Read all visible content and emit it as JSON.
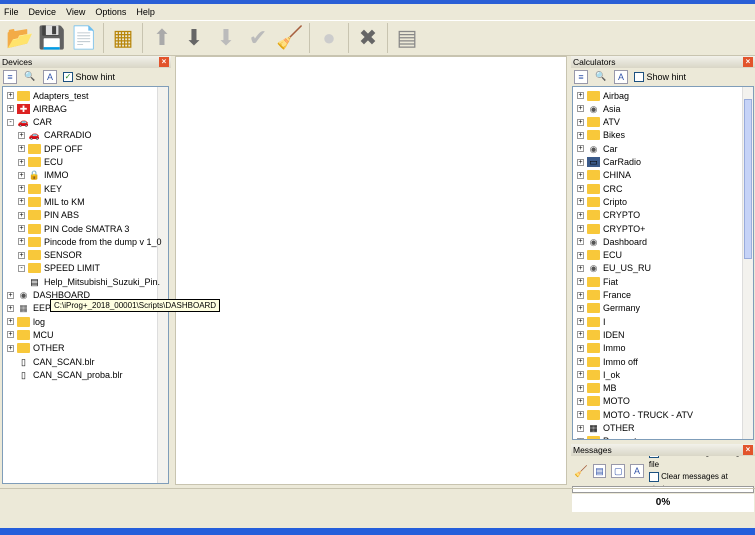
{
  "menu": [
    "File",
    "Device",
    "View",
    "Options",
    "Help"
  ],
  "toolbar": [
    {
      "icon": "open-folder-icon",
      "g": "📂",
      "c": "#3a7bd5"
    },
    {
      "icon": "save-download-icon",
      "g": "💾",
      "c": "#3a9a3a"
    },
    {
      "icon": "new-script-icon",
      "g": "📄",
      "c": "#c80"
    },
    "sep",
    {
      "icon": "device-chip-icon",
      "g": "▦",
      "c": "#b8860b"
    },
    "sep",
    {
      "icon": "arrow-up-icon",
      "g": "⬆",
      "c": "#aaa"
    },
    {
      "icon": "arrow-down-icon",
      "g": "⬇",
      "c": "#666"
    },
    {
      "icon": "arrow-down-disabled-icon",
      "g": "⬇",
      "c": "#bbb"
    },
    {
      "icon": "check-icon",
      "g": "✔",
      "c": "#bbb"
    },
    {
      "icon": "broom-icon",
      "g": "🧹",
      "c": "#bbb"
    },
    "sep",
    {
      "icon": "stop-circle-icon",
      "g": "●",
      "c": "#ccc"
    },
    "sep",
    {
      "icon": "close-x-icon",
      "g": "✖",
      "c": "#666"
    },
    "sep",
    {
      "icon": "calculator-icon",
      "g": "▤",
      "c": "#888"
    }
  ],
  "devices": {
    "title": "Devices",
    "show_hint": "Show hint",
    "show_hint_checked": true,
    "items": [
      {
        "label": "Adapters_test",
        "level": 0,
        "icon": "folder",
        "exp": "+"
      },
      {
        "label": "AIRBAG",
        "level": 0,
        "icon": "airbag",
        "exp": "+"
      },
      {
        "label": "CAR",
        "level": 0,
        "icon": "car",
        "exp": "-"
      },
      {
        "label": "CARRADIO",
        "level": 1,
        "icon": "car",
        "exp": "+"
      },
      {
        "label": "DPF OFF",
        "level": 1,
        "icon": "folder",
        "exp": "+"
      },
      {
        "label": "ECU",
        "level": 1,
        "icon": "folder",
        "exp": "+"
      },
      {
        "label": "IMMO",
        "level": 1,
        "icon": "lock",
        "exp": "+"
      },
      {
        "label": "KEY",
        "level": 1,
        "icon": "folder",
        "exp": "+"
      },
      {
        "label": "MIL to KM",
        "level": 1,
        "icon": "folder",
        "exp": "+"
      },
      {
        "label": "PIN ABS",
        "level": 1,
        "icon": "folder",
        "exp": "+"
      },
      {
        "label": "PIN Code SMATRA 3",
        "level": 1,
        "icon": "folder",
        "exp": "+"
      },
      {
        "label": "Pincode from the dump v 1_0",
        "level": 1,
        "icon": "folder",
        "exp": "+"
      },
      {
        "label": "SENSOR",
        "level": 1,
        "icon": "folder",
        "exp": "+"
      },
      {
        "label": "SPEED LIMIT",
        "level": 1,
        "icon": "folder",
        "exp": "-"
      },
      {
        "label": "Help_Mitsubishi_Suzuki_Pin.",
        "level": 1,
        "icon": "script",
        "exp": ""
      },
      {
        "label": "DASHBOARD",
        "level": 0,
        "icon": "dashboard",
        "exp": "+"
      },
      {
        "label": "EEP",
        "level": 0,
        "icon": "chip",
        "exp": "+"
      },
      {
        "label": "log",
        "level": 0,
        "icon": "folder",
        "exp": "+"
      },
      {
        "label": "MCU",
        "level": 0,
        "icon": "folder",
        "exp": "+"
      },
      {
        "label": "OTHER",
        "level": 0,
        "icon": "folder",
        "exp": "+"
      },
      {
        "label": "CAN_SCAN.blr",
        "level": 0,
        "icon": "file",
        "exp": ""
      },
      {
        "label": "CAN_SCAN_proba.blr",
        "level": 0,
        "icon": "file",
        "exp": ""
      }
    ],
    "tooltip": "C:\\iProg+_2018_00001\\Scripts\\DASHBOARD"
  },
  "calculators": {
    "title": "Calculators",
    "show_hint": "Show hint",
    "show_hint_checked": false,
    "items": [
      {
        "label": "Airbag",
        "icon": "folder"
      },
      {
        "label": "Asia",
        "icon": "dashboard"
      },
      {
        "label": "ATV",
        "icon": "folder"
      },
      {
        "label": "Bikes",
        "icon": "folder"
      },
      {
        "label": "Car",
        "icon": "dashboard"
      },
      {
        "label": "CarRadio",
        "icon": "radio"
      },
      {
        "label": "CHINA",
        "icon": "folder"
      },
      {
        "label": "CRC",
        "icon": "folder"
      },
      {
        "label": "Cripto",
        "icon": "folder"
      },
      {
        "label": "CRYPTO",
        "icon": "folder"
      },
      {
        "label": "CRYPTO+",
        "icon": "folder"
      },
      {
        "label": "Dashboard",
        "icon": "dashboard"
      },
      {
        "label": "ECU",
        "icon": "folder"
      },
      {
        "label": "EU_US_RU",
        "icon": "dashboard"
      },
      {
        "label": "Fiat",
        "icon": "folder"
      },
      {
        "label": "France",
        "icon": "folder"
      },
      {
        "label": "Germany",
        "icon": "folder"
      },
      {
        "label": "I",
        "icon": "folder"
      },
      {
        "label": "IDEN",
        "icon": "folder"
      },
      {
        "label": "Immo",
        "icon": "folder"
      },
      {
        "label": "Immo off",
        "icon": "folder"
      },
      {
        "label": "I_ok",
        "icon": "folder"
      },
      {
        "label": "MB",
        "icon": "folder"
      },
      {
        "label": "MOTO",
        "icon": "folder"
      },
      {
        "label": "MOTO - TRUCK - ATV",
        "icon": "folder"
      },
      {
        "label": "OTHER",
        "icon": "calculator"
      },
      {
        "label": "Peugeot",
        "icon": "folder"
      }
    ]
  },
  "messages": {
    "title": "Messages",
    "save_log": "Save messages to log file",
    "clear_startup": "Clear messages at startup",
    "progress": "0%",
    "progress_value": 0
  }
}
